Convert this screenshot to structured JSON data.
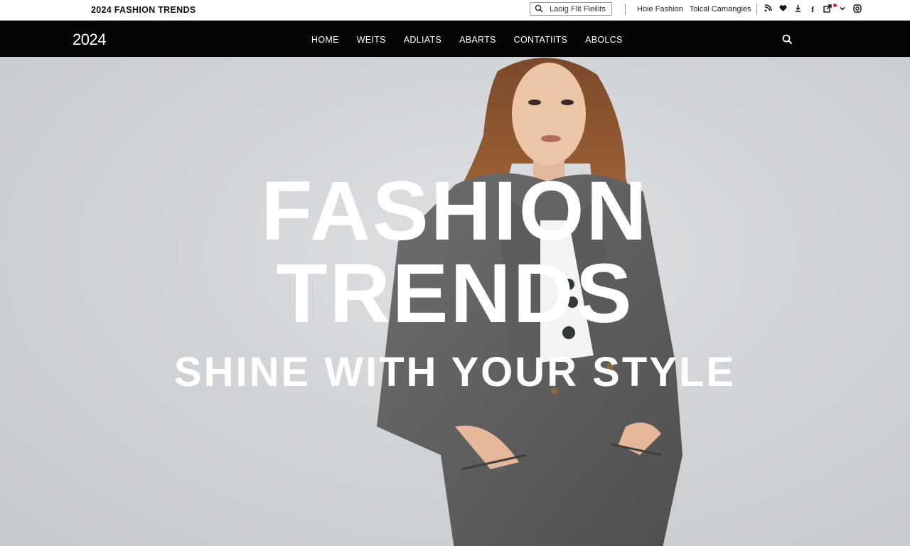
{
  "topbar": {
    "brand": "2024 FASHION TRENDS",
    "search_placeholder": "Laoig Flit Fleilits",
    "links": [
      "Hoie Fashion",
      "Toical Camangies"
    ],
    "icons": [
      "feed-icon",
      "heart-icon",
      "download-icon",
      "facebook-icon",
      "share-icon",
      "chevron-down-icon",
      "instagram-icon"
    ]
  },
  "navbar": {
    "logo": "2024",
    "items": [
      "HOME",
      "WEITS",
      "ADLIATS",
      "ABARTS",
      "CONTATIITS",
      "ABOLCS"
    ]
  },
  "hero": {
    "line1": "FASHION",
    "line2": "TRENDS",
    "tagline": "SHINE WITH YOUR STYLE"
  },
  "colors": {
    "navbar_bg": "#050505",
    "hero_bg": "#ced1d4",
    "headline": "#ffffff"
  }
}
